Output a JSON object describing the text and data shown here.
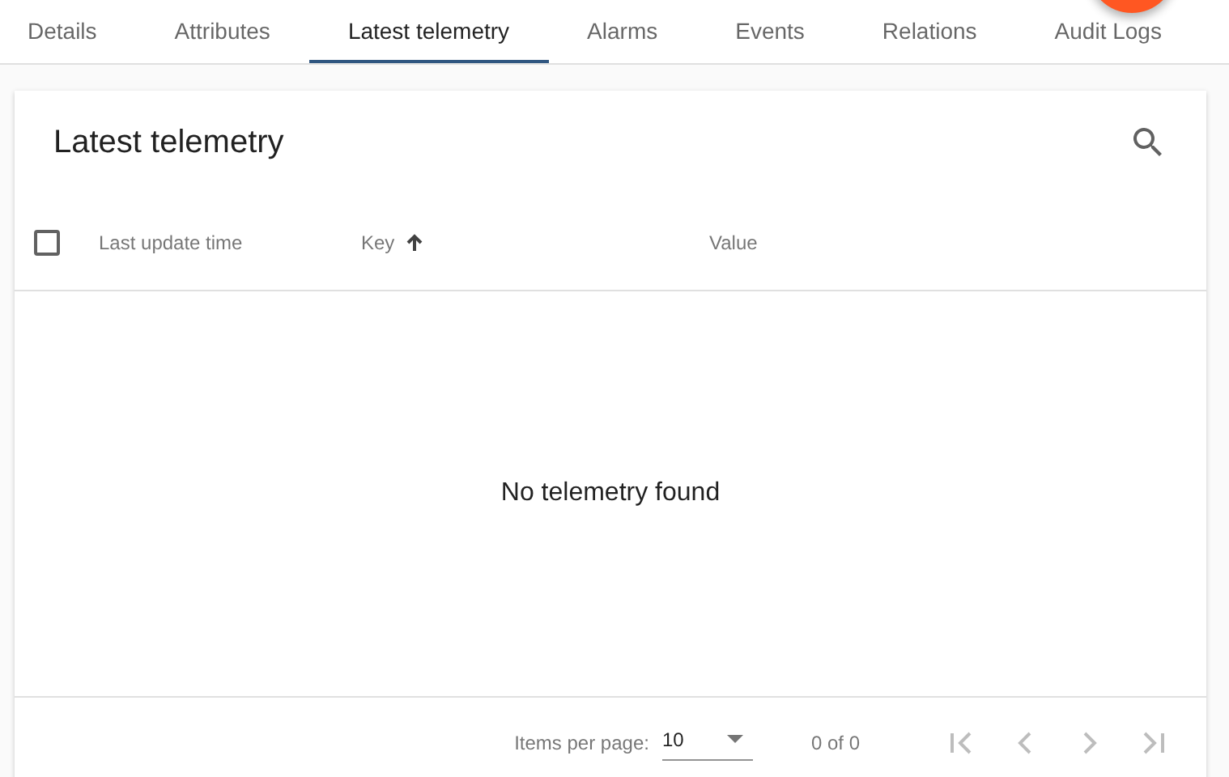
{
  "tabs": [
    {
      "label": "Details",
      "selected": false
    },
    {
      "label": "Attributes",
      "selected": false
    },
    {
      "label": "Latest telemetry",
      "selected": true
    },
    {
      "label": "Alarms",
      "selected": false
    },
    {
      "label": "Events",
      "selected": false
    },
    {
      "label": "Relations",
      "selected": false
    },
    {
      "label": "Audit Logs",
      "selected": false
    }
  ],
  "card": {
    "title": "Latest telemetry",
    "table": {
      "select_all_checked": false,
      "columns": [
        {
          "label": "Last update time",
          "sorted": false
        },
        {
          "label": "Key",
          "sorted": true
        },
        {
          "label": "Value",
          "sorted": false
        }
      ],
      "empty_message": "No telemetry found"
    },
    "paginator": {
      "items_per_page_label": "Items per page:",
      "page_size": "10",
      "range": "0 of 0",
      "buttons": [
        {
          "kind": "first",
          "disabled": true
        },
        {
          "kind": "previous",
          "disabled": true
        },
        {
          "kind": "next",
          "disabled": true
        },
        {
          "kind": "last",
          "disabled": true
        }
      ]
    }
  }
}
